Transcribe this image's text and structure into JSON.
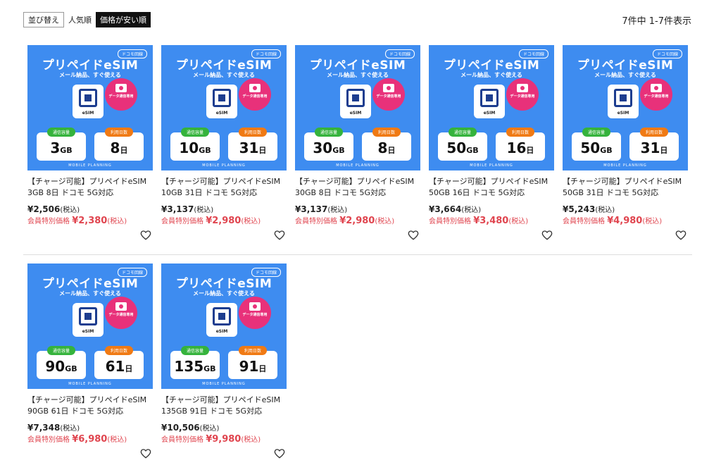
{
  "sort": {
    "label": "並び替え",
    "options": [
      "人気順",
      "価格が安い順"
    ],
    "active_index": 1
  },
  "result_count": "7件中 1-7件表示",
  "thumbnail": {
    "tag": "ドコモ回線",
    "title": "プリペイドeSIM",
    "subtitle": "メール納品、すぐ使える",
    "chip_label": "eSIM",
    "badge_text": "データ通信専用",
    "data_label": "通信容量",
    "days_label": "利用日数",
    "data_unit": "GB",
    "days_unit": "日",
    "footer": "MOBILE PLANNING"
  },
  "tax_label": "(税込)",
  "member_label": "会員特別価格",
  "products": [
    {
      "data": "3",
      "days": "8",
      "name_line1": "【チャージ可能】プリペイドeSIM",
      "name_line2": "3GB 8日 ドコモ 5G対応",
      "price": "¥2,506",
      "member_price": "¥2,380"
    },
    {
      "data": "10",
      "days": "31",
      "name_line1": "【チャージ可能】プリペイドeSIM",
      "name_line2": "10GB 31日 ドコモ 5G対応",
      "price": "¥3,137",
      "member_price": "¥2,980"
    },
    {
      "data": "30",
      "days": "8",
      "name_line1": "【チャージ可能】プリペイドeSIM",
      "name_line2": "30GB 8日 ドコモ 5G対応",
      "price": "¥3,137",
      "member_price": "¥2,980"
    },
    {
      "data": "50",
      "days": "16",
      "name_line1": "【チャージ可能】プリペイドeSIM",
      "name_line2": "50GB 16日 ドコモ 5G対応",
      "price": "¥3,664",
      "member_price": "¥3,480"
    },
    {
      "data": "50",
      "days": "31",
      "name_line1": "【チャージ可能】プリペイドeSIM",
      "name_line2": "50GB 31日 ドコモ 5G対応",
      "price": "¥5,243",
      "member_price": "¥4,980"
    },
    {
      "data": "90",
      "days": "61",
      "name_line1": "【チャージ可能】プリペイドeSIM",
      "name_line2": "90GB 61日 ドコモ 5G対応",
      "price": "¥7,348",
      "member_price": "¥6,980"
    },
    {
      "data": "135",
      "days": "91",
      "name_line1": "【チャージ可能】プリペイドeSIM",
      "name_line2": "135GB 91日 ドコモ 5G対応",
      "price": "¥10,506",
      "member_price": "¥9,980"
    }
  ],
  "icons": {
    "favorite": "heart-outline-icon"
  },
  "colors": {
    "thumb_bg": "#3e8cf0",
    "accent_pink": "#e8317a",
    "member_red": "#e0454f",
    "green": "#35b33c",
    "orange": "#f07a14"
  }
}
